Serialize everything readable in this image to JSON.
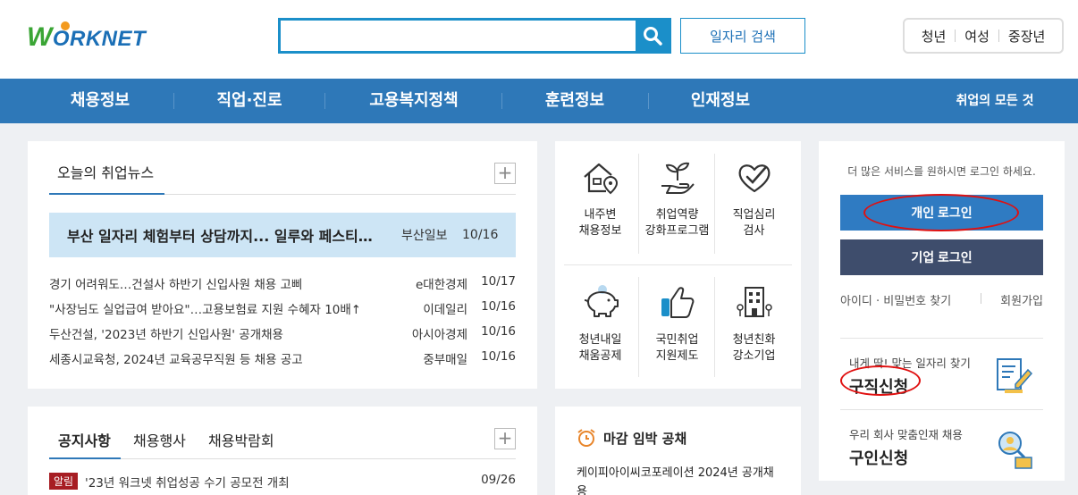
{
  "header": {
    "logo_text": "ORKNET",
    "logo_letter": "W",
    "search": {
      "value": "",
      "placeholder": ""
    },
    "job_search_label": "일자리 검색",
    "age_tabs": [
      "청년",
      "여성",
      "중장년"
    ]
  },
  "nav": {
    "items": [
      "채용정보",
      "직업·진로",
      "고용복지정책",
      "훈련정보",
      "인재정보"
    ],
    "right": "취업의 모든 것"
  },
  "news": {
    "tab": "오늘의 취업뉴스",
    "headline": {
      "title": "부산 일자리 체험부터 상담까지... 일루와 페스티…",
      "source": "부산일보",
      "date": "10/16"
    },
    "items": [
      {
        "title": "경기 어려워도…건설사 하반기 신입사원 채용 고삐",
        "source": "e대한경제",
        "date": "10/17"
      },
      {
        "title": "\"사장님도 실업급여 받아요\"…고용보험료 지원 수혜자 10배↑",
        "source": "이데일리",
        "date": "10/16"
      },
      {
        "title": "두산건설, '2023년 하반기 신입사원' 공개채용",
        "source": "아시아경제",
        "date": "10/16"
      },
      {
        "title": "세종시교육청, 2024년 교육공무직원 등 채용 공고",
        "source": "중부매일",
        "date": "10/16"
      }
    ]
  },
  "menu": {
    "items": [
      {
        "label1": "내주변",
        "label2": "채용정보",
        "icon": "house-location-icon"
      },
      {
        "label1": "취업역량",
        "label2": "강화프로그램",
        "icon": "sprout-hand-icon"
      },
      {
        "label1": "직업심리",
        "label2": "검사",
        "icon": "heart-check-icon"
      },
      {
        "label1": "청년내일",
        "label2": "채움공제",
        "icon": "piggy-bank-icon"
      },
      {
        "label1": "국민취업",
        "label2": "지원제도",
        "icon": "thumbs-up-icon"
      },
      {
        "label1": "청년친화",
        "label2": "강소기업",
        "icon": "building-icon"
      }
    ]
  },
  "login": {
    "message": "더 많은 서비스를 원하시면 로그인 하세요.",
    "personal_label": "개인 로그인",
    "company_label": "기업 로그인",
    "find_label": "아이디 · 비밀번호 찾기",
    "join_label": "회원가입",
    "job_seek": {
      "sub": "내게 딱! 맞는 일자리 찾기",
      "main": "구직신청"
    },
    "job_offer": {
      "sub": "우리 회사 맞춤인재 채용",
      "main": "구인신청"
    }
  },
  "notice": {
    "tabs": [
      "공지사항",
      "채용행사",
      "채용박람회"
    ],
    "item": {
      "badge": "알림",
      "title": "'23년 워크넷 취업성공 수기 공모전 개최",
      "date": "09/26"
    }
  },
  "deadline": {
    "title": "마감 임박 공채",
    "item": "케이피아이씨코포레이션  2024년 공개채용"
  },
  "colors": {
    "nav": "#2e78b8",
    "accent": "#1b8fc9",
    "annotation": "#e01010"
  }
}
